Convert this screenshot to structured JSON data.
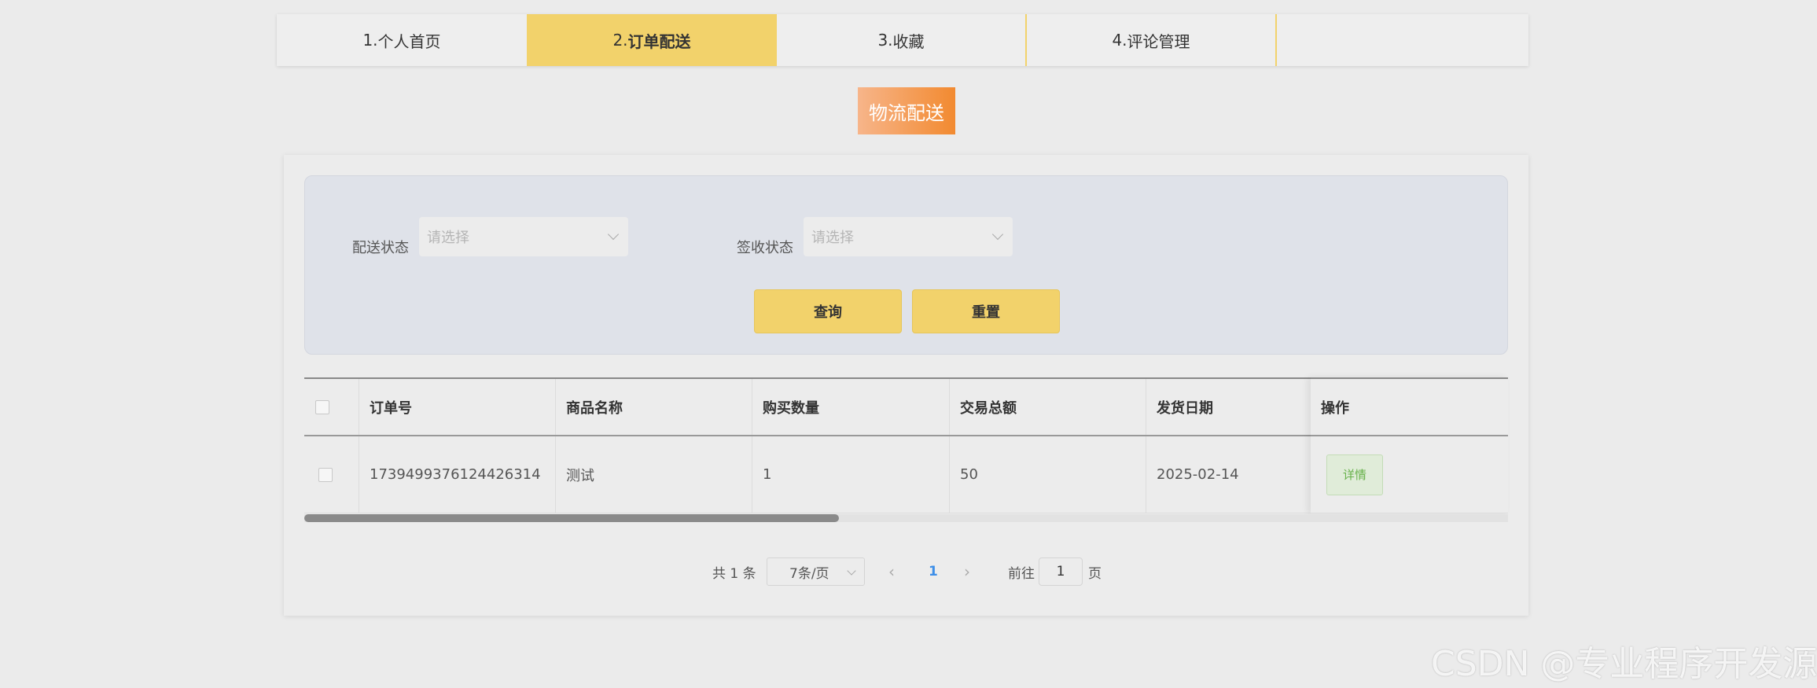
{
  "tabs": [
    {
      "num": "1. ",
      "label": "个人首页"
    },
    {
      "num": "2. ",
      "label": "订单配送"
    },
    {
      "num": "3. ",
      "label": "收藏"
    },
    {
      "num": "4. ",
      "label": "评论管理"
    }
  ],
  "section_title": "物流配送",
  "filters": {
    "delivery_status_label": "配送状态",
    "delivery_status_placeholder": "请选择",
    "sign_status_label": "签收状态",
    "sign_status_placeholder": "请选择",
    "query_button": "查询",
    "reset_button": "重置"
  },
  "table": {
    "columns": [
      "订单号",
      "商品名称",
      "购买数量",
      "交易总额",
      "发货日期",
      "操作"
    ],
    "rows": [
      {
        "order_no": "1739499376124426314",
        "product_name": "测试",
        "quantity": "1",
        "total": "50",
        "ship_date": "2025-02-14",
        "action": "详情"
      }
    ]
  },
  "pagination": {
    "total_text": "共 1 条",
    "page_size": "7条/页",
    "current_page": "1",
    "goto_label": "前往",
    "goto_value": "1",
    "page_suffix": "页"
  },
  "colors": {
    "accent_yellow": "#f2d26b",
    "title_orange_start": "#f7b58a",
    "title_orange_end": "#f28a30",
    "link_blue": "#3d8ee8",
    "detail_green": "#67b14a"
  },
  "watermark": "CSDN @专业程序开发源"
}
